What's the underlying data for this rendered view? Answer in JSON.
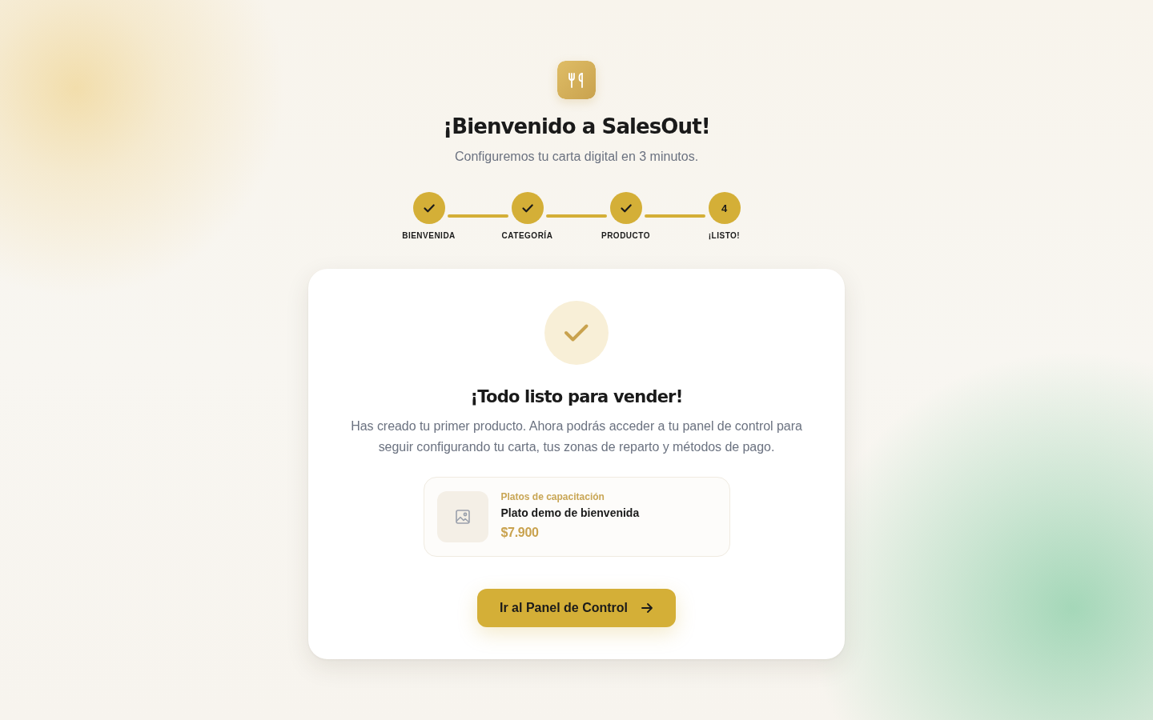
{
  "header": {
    "title": "¡Bienvenido a SalesOut!",
    "subtitle": "Configuremos tu carta digital en 3 minutos."
  },
  "steps": [
    {
      "label": "BIENVENIDA",
      "completed": true
    },
    {
      "label": "CATEGORÍA",
      "completed": true
    },
    {
      "label": "PRODUCTO",
      "completed": true
    },
    {
      "label": "¡LISTO!",
      "completed": false,
      "number": "4"
    }
  ],
  "card": {
    "title": "¡Todo listo para vender!",
    "message": "Has creado tu primer producto. Ahora podrás acceder a tu panel de control para seguir configurando tu carta, tus zonas de reparto y métodos de pago.",
    "product": {
      "category": "Platos de capacitación",
      "name": "Plato demo de bienvenida",
      "price": "$7.900"
    },
    "button": {
      "label": "Ir al Panel de Control"
    }
  }
}
